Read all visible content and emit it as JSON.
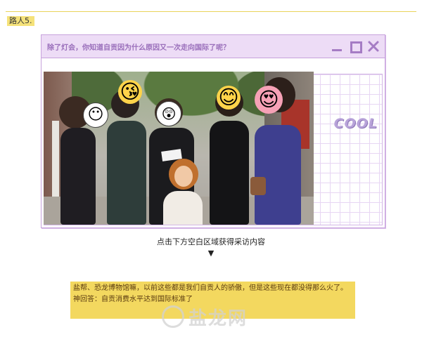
{
  "header": {
    "tag": "路人5."
  },
  "window": {
    "title": "除了灯会，你知道自贡因为什么原因又一次走向国际了呢？",
    "side_text": "COOL",
    "controls": [
      "minimize-icon",
      "maximize-icon",
      "close-icon"
    ]
  },
  "photo": {
    "face_stickers": [
      "😶",
      "😘",
      "😲",
      "😊",
      "😍"
    ]
  },
  "hint": {
    "text": "点击下方空白区域获得采访内容",
    "arrow": "▼"
  },
  "answer": {
    "line1": "盐帮、恐龙博物馆嘛，以前这些都是我们自贡人的骄傲，但是这些现在都没得那么火了。",
    "line2": "神回答：自贡消费水平达到国际标准了"
  },
  "watermark": {
    "text": "盐龙网"
  },
  "colors": {
    "accent": "#c7a2dc",
    "tag_bg": "#f5e27a",
    "answer_bg": "#f3d85f"
  }
}
